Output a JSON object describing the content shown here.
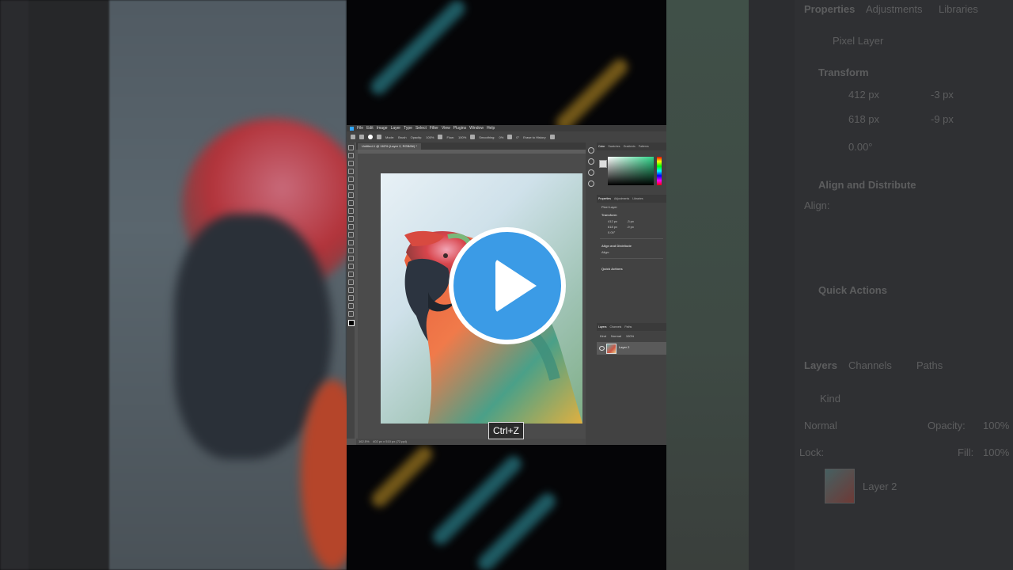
{
  "menu": [
    "File",
    "Edit",
    "Image",
    "Layer",
    "Type",
    "Select",
    "Filter",
    "View",
    "Plugins",
    "Window",
    "Help"
  ],
  "options": {
    "mode_label": "Mode:",
    "mode_value": "Brush",
    "opacity_label": "Opacity:",
    "opacity_value": "100%",
    "flow_label": "Flow:",
    "flow_value": "100%",
    "smoothing_label": "Smoothing:",
    "smoothing_value": "0%",
    "angle_value": "0°",
    "erase_history": "Erase to History"
  },
  "document_tab": "Untitled-1 @ 162% (Layer 2, RGB/8#) *",
  "status_bar": {
    "zoom": "162.5%",
    "info": "402 px x 510 px (72 ppi)"
  },
  "color_panel": {
    "tabs": [
      "Color",
      "Swatches",
      "Gradients",
      "Patterns"
    ],
    "active_tab": "Color"
  },
  "properties_panel": {
    "tabs": [
      "Properties",
      "Adjustments",
      "Libraries"
    ],
    "layer_type": "Pixel Layer",
    "transform_title": "Transform",
    "w": "412 px",
    "h": "618 px",
    "x": "-3 px",
    "y": "-9 px",
    "angle": "0.00°",
    "align_title": "Align and Distribute",
    "align_label": "Align:",
    "quick_actions": "Quick Actions"
  },
  "layers_panel": {
    "tabs": [
      "Layers",
      "Channels",
      "Paths"
    ],
    "kind": "Kind",
    "blend": "Normal",
    "opacity_label": "Opacity:",
    "opacity": "100%",
    "lock_label": "Lock:",
    "fill_label": "Fill:",
    "fill": "100%",
    "layer_name": "Layer 2"
  },
  "overlay": {
    "shortcut": "Ctrl+Z"
  },
  "colors": {
    "play_blue": "#3b9be6",
    "ps_bg": "#535353"
  }
}
